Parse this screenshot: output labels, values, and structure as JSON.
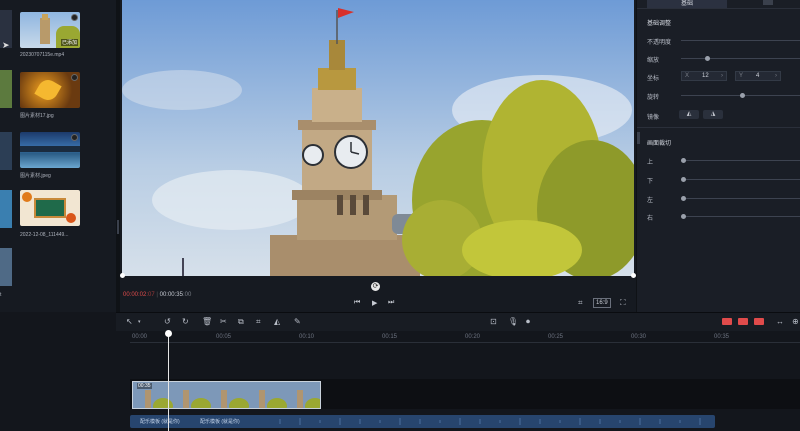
{
  "media": {
    "items": [
      {
        "name": "20230707115e.mp4",
        "badge": "已添加"
      },
      {
        "name": "图片素材17.jpg",
        "badge": ""
      },
      {
        "name": "图片素材.jpeg",
        "badge": ""
      },
      {
        "name": "2022-12-08_111449...",
        "badge": ""
      }
    ],
    "left_strip_label": "t"
  },
  "preview": {
    "current_time": "00:00:02",
    "current_frame": "07",
    "total_time": "00:00:35",
    "total_frame": "00",
    "aspect_ratio": "16:9"
  },
  "properties": {
    "tab_active": "基础",
    "section_basic": "基础调整",
    "opacity_label": "不透明度",
    "scale_label": "缩放",
    "position_label": "坐标",
    "pos_x_label": "X",
    "pos_x": "12",
    "pos_y_label": "Y",
    "pos_y": "4",
    "rotate_label": "旋转",
    "mirror_label": "镜像",
    "section_crop": "画面裁切",
    "crop_top": "上",
    "crop_bottom": "下",
    "crop_left": "左",
    "crop_right": "右"
  },
  "timeline": {
    "ruler_labels": [
      "00:00",
      "00:05",
      "00:10",
      "00:15",
      "00:20",
      "00:25",
      "00:30",
      "00:35"
    ],
    "clip_label": "00:35",
    "audio_labels": [
      "配乐模板 (就是你)",
      "配乐模板 (就是你)"
    ]
  },
  "colors": {
    "accent": "#3a6fd8",
    "current_time": "#e04b4b",
    "audio_track": "#27456e"
  }
}
